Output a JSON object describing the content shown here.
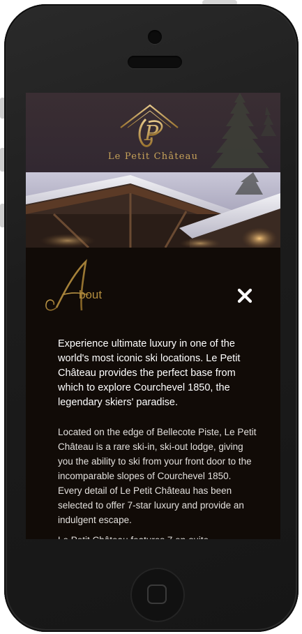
{
  "brand": {
    "name": "Le Petit Château",
    "logo_letter": "P"
  },
  "about": {
    "heading_initial": "A",
    "heading_rest": "bout",
    "close_icon": "close-icon"
  },
  "copy": {
    "lead": "Experience ultimate luxury in one of the world's most iconic ski locations. Le Petit Château provides the perfect base from which to explore Courchevel 1850, the legendary skiers' paradise.",
    "body": "Located on the edge of Bellecote Piste, Le Petit Château is a rare ski-in, ski-out lodge, giving you the ability to ski from your front door to the incomparable slopes of Courchevel 1850. Every detail of Le Petit Château has been selected to offer 7-star luxury and provide an indulgent escape.",
    "more": "Le Petit Château features 7 en-suite"
  },
  "colors": {
    "gold": "#b38d3e",
    "header_bg": "#3a2e33",
    "content_bg": "#110b07"
  }
}
